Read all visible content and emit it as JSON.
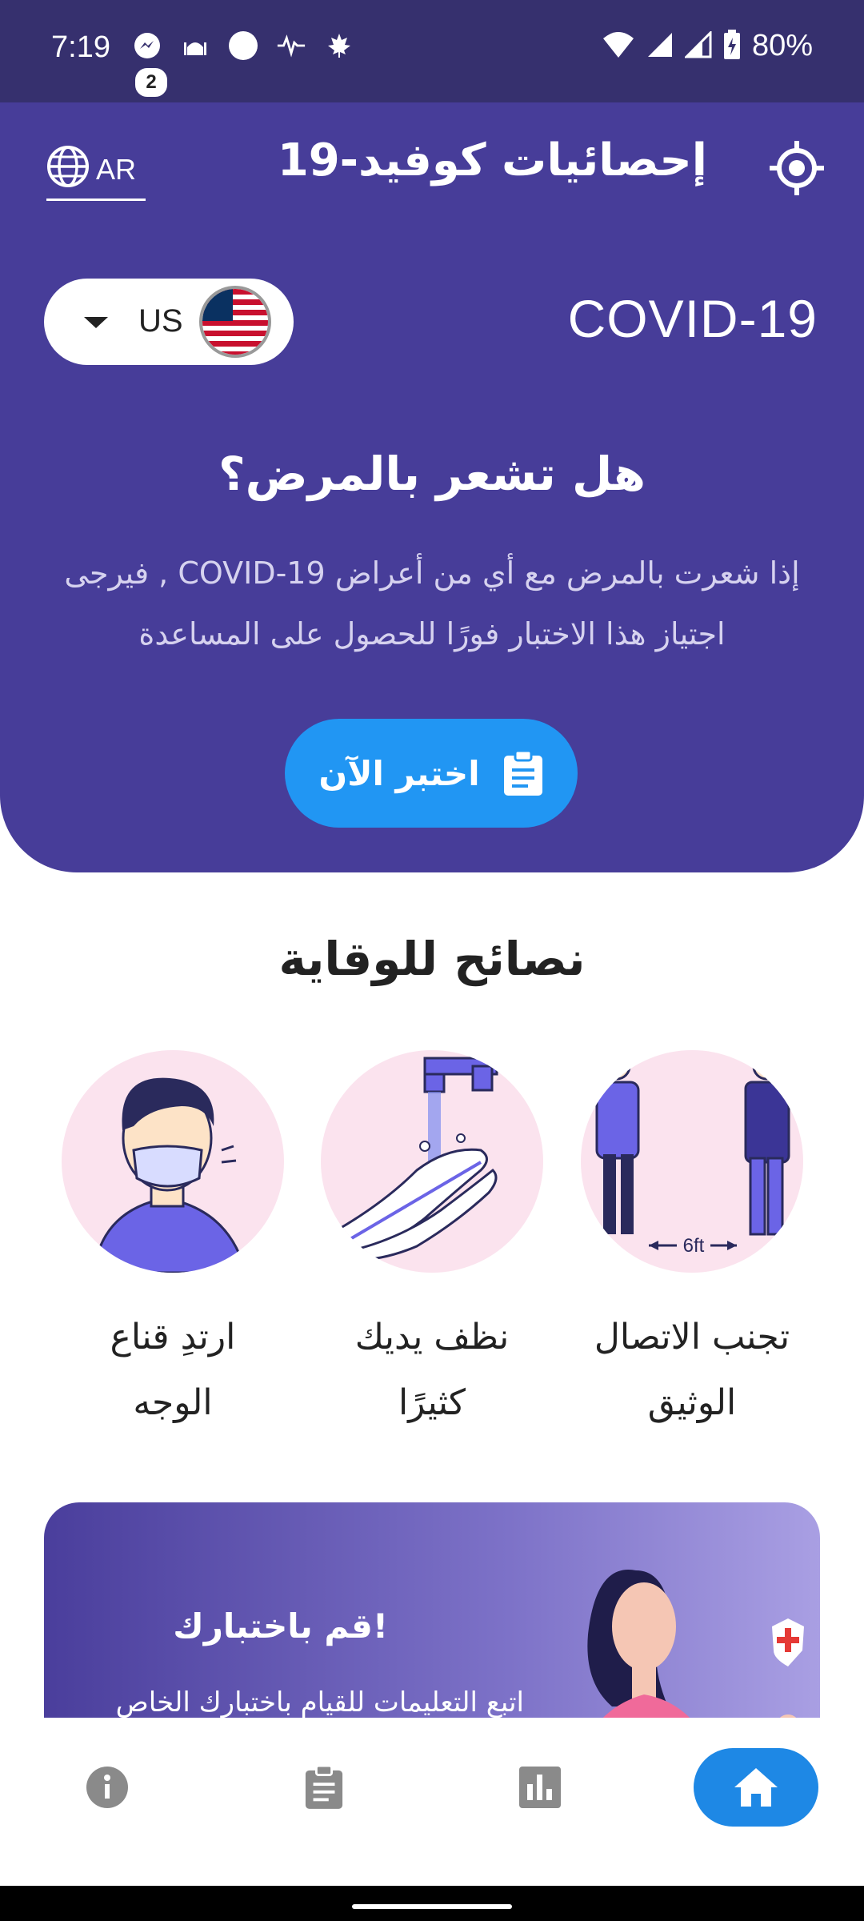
{
  "status_bar": {
    "time": "7:19",
    "notification_badge": "2",
    "battery": "80%"
  },
  "header": {
    "language_label": "AR",
    "title": "إحصائيات كوفيد-19"
  },
  "country": {
    "code": "US"
  },
  "hero": {
    "covid_label": "COVID-19",
    "sick_title": "هل تشعر بالمرض؟",
    "sick_description": "إذا شعرت بالمرض مع أي من أعراض COVID-19 , فيرجى اجتياز هذا الاختبار فورًا للحصول على المساعدة",
    "test_button": "اختبر الآن"
  },
  "prevention": {
    "title": "نصائح للوقاية",
    "tips": [
      {
        "label_line1": "تجنب الاتصال",
        "label_line2": "الوثيق",
        "illustration_text": "6ft"
      },
      {
        "label_line1": "نظف يديك",
        "label_line2": "كثيرًا"
      },
      {
        "label_line1": "ارتدِ قناع",
        "label_line2": "الوجه"
      }
    ]
  },
  "banner": {
    "title": "قم باختبارك!",
    "description": "اتبع التعليمات للقيام باختبارك الخاص"
  },
  "colors": {
    "hero_bg": "#473d99",
    "status_bg": "#36306e",
    "accent_blue": "#2196f3",
    "nav_active": "#1e88e5"
  },
  "bottom_nav": [
    "info-icon",
    "clipboard-icon",
    "bar-chart-icon",
    "home-icon"
  ]
}
